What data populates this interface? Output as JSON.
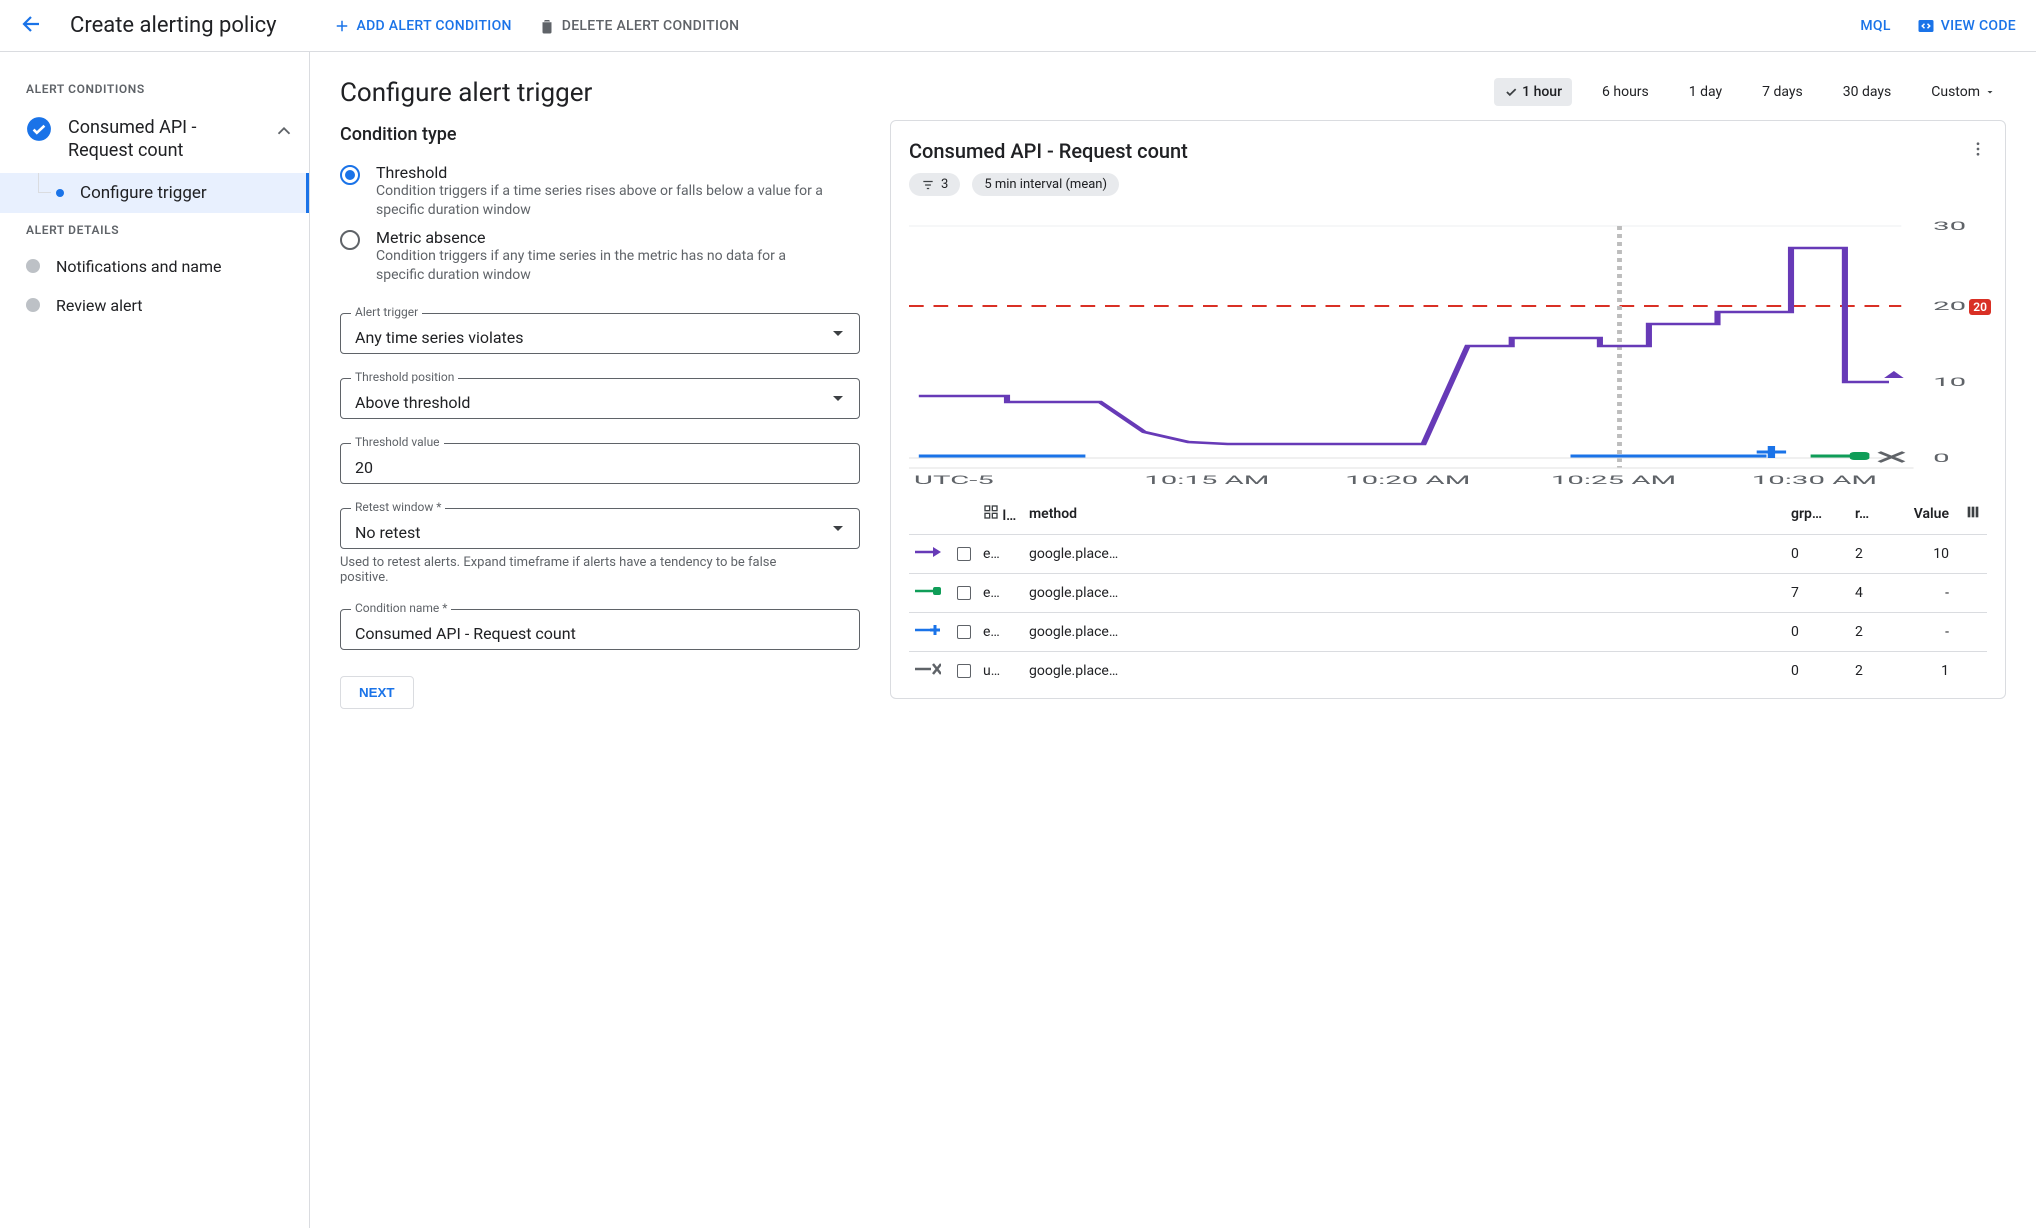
{
  "toolbar": {
    "title": "Create alerting policy",
    "add_condition": "ADD ALERT CONDITION",
    "delete_condition": "DELETE ALERT CONDITION",
    "mql": "MQL",
    "view_code": "VIEW CODE"
  },
  "sidebar": {
    "conditions_label": "ALERT CONDITIONS",
    "condition_name": "Consumed API - Request count",
    "configure_trigger": "Configure trigger",
    "details_label": "ALERT DETAILS",
    "notifications": "Notifications and name",
    "review": "Review alert"
  },
  "form": {
    "heading": "Configure alert trigger",
    "condition_type_label": "Condition type",
    "threshold": {
      "label": "Threshold",
      "desc": "Condition triggers if a time series rises above or falls below a value for a specific duration window"
    },
    "absence": {
      "label": "Metric absence",
      "desc": "Condition triggers if any time series in the metric has no data for a specific duration window"
    },
    "alert_trigger_label": "Alert trigger",
    "alert_trigger_value": "Any time series violates",
    "threshold_position_label": "Threshold position",
    "threshold_position_value": "Above threshold",
    "threshold_value_label": "Threshold value",
    "threshold_value": "20",
    "retest_label": "Retest window *",
    "retest_value": "No retest",
    "retest_hint": "Used to retest alerts. Expand timeframe if alerts have a tendency to be false positive.",
    "condition_name_label": "Condition name *",
    "condition_name_value": "Consumed API - Request count",
    "next": "NEXT"
  },
  "time_range": {
    "options": [
      "1 hour",
      "6 hours",
      "1 day",
      "7 days",
      "30 days",
      "Custom"
    ],
    "active": "1 hour"
  },
  "preview": {
    "title": "Consumed API - Request count",
    "filter_count": "3",
    "interval": "5 min interval (mean)",
    "y_ticks": [
      "30",
      "20",
      "10",
      "0"
    ],
    "x_tz": "UTC-5",
    "x_ticks": [
      "10:15 AM",
      "10:20 AM",
      "10:25 AM",
      "10:30 AM"
    ],
    "threshold_badge": "20",
    "columns": [
      "l…",
      "method",
      "grp…",
      "r…",
      "Value"
    ],
    "rows": [
      {
        "mark_color": "#673ab7",
        "mark_shape": "triangle",
        "l": "e…",
        "method": "google.place…",
        "grp": "0",
        "r": "2",
        "value": "10"
      },
      {
        "mark_color": "#0f9d58",
        "mark_shape": "square",
        "l": "e…",
        "method": "google.place…",
        "grp": "7",
        "r": "4",
        "value": "-"
      },
      {
        "mark_color": "#1a73e8",
        "mark_shape": "plus",
        "l": "e…",
        "method": "google.place…",
        "grp": "0",
        "r": "2",
        "value": "-"
      },
      {
        "mark_color": "#5f6368",
        "mark_shape": "x",
        "l": "u…",
        "method": "google.place…",
        "grp": "0",
        "r": "2",
        "value": "1"
      }
    ]
  },
  "chart_data": {
    "type": "line",
    "title": "Consumed API - Request count",
    "xlabel": "UTC-5",
    "ylabel": "",
    "ylim": [
      0,
      30
    ],
    "x": [
      "10:11",
      "10:12",
      "10:13",
      "10:14",
      "10:15",
      "10:16",
      "10:17",
      "10:18",
      "10:19",
      "10:20",
      "10:21",
      "10:22",
      "10:23",
      "10:24",
      "10:25",
      "10:26",
      "10:27",
      "10:28",
      "10:29",
      "10:30",
      "10:31"
    ],
    "threshold": 20,
    "series": [
      {
        "name": "e… google.place… (purple)",
        "color": "#673ab7",
        "values": [
          8,
          8,
          8,
          7,
          7,
          7,
          4,
          3,
          2,
          2,
          2,
          2,
          14,
          14,
          15,
          15,
          14,
          17,
          17,
          19,
          29,
          29,
          10
        ]
      },
      {
        "name": "e… google.place… (green)",
        "color": "#0f9d58",
        "values": [
          null,
          null,
          null,
          null,
          null,
          null,
          null,
          null,
          null,
          null,
          null,
          null,
          null,
          null,
          null,
          null,
          null,
          null,
          0,
          0,
          0,
          null
        ]
      },
      {
        "name": "e… google.place… (blue)",
        "color": "#1a73e8",
        "values": [
          0,
          0,
          0,
          0,
          0,
          0,
          null,
          null,
          null,
          null,
          null,
          null,
          null,
          null,
          null,
          null,
          0,
          0,
          0,
          0,
          0,
          null
        ]
      },
      {
        "name": "u… google.place… (grey)",
        "color": "#5f6368",
        "values": [
          null,
          null,
          null,
          null,
          null,
          null,
          null,
          null,
          null,
          null,
          null,
          null,
          null,
          null,
          null,
          null,
          null,
          null,
          null,
          null,
          1,
          null
        ]
      }
    ]
  }
}
